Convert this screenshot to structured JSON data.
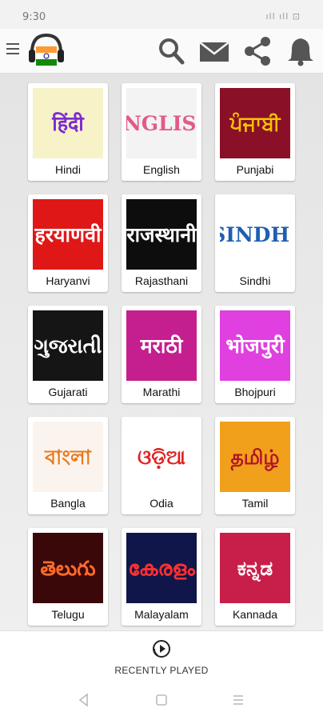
{
  "status": {
    "time": "9:30",
    "signal_text": "ıll ıll ⊡"
  },
  "header": {
    "menu_icon": "hamburger-icon",
    "logo_icon": "india-flag-headphones-icon",
    "actions": [
      "search-icon",
      "mail-icon",
      "share-icon",
      "bell-icon"
    ]
  },
  "languages": [
    {
      "label": "Hindi",
      "script": "हिंदी",
      "bg": "#f7f2c8",
      "fg": "#7b2bd1"
    },
    {
      "label": "English",
      "script": "ENGLISH",
      "bg": "#f3f3f3",
      "fg": "#e25a8a"
    },
    {
      "label": "Punjabi",
      "script": "ਪੰਜਾਬੀ",
      "bg": "#8a1028",
      "fg": "#f4c400"
    },
    {
      "label": "Haryanvi",
      "script": "हरयाणवी",
      "bg": "#e01717",
      "fg": "#ffffff"
    },
    {
      "label": "Rajasthani",
      "script": "राजस्थानी",
      "bg": "#0d0d0d",
      "fg": "#ffffff"
    },
    {
      "label": "Sindhi",
      "script": "SINDHI",
      "bg": "#ffffff",
      "fg": "#1e5fb0"
    },
    {
      "label": "Gujarati",
      "script": "ગુજરાતી",
      "bg": "#151515",
      "fg": "#ffffff"
    },
    {
      "label": "Marathi",
      "script": "मराठी",
      "bg": "#c51e8f",
      "fg": "#ffffff"
    },
    {
      "label": "Bhojpuri",
      "script": "भोजपुरी",
      "bg": "#e040e0",
      "fg": "#ffffff"
    },
    {
      "label": "Bangla",
      "script": "বাংলা",
      "bg": "#fbf4ee",
      "fg": "#e87a1e"
    },
    {
      "label": "Odia",
      "script": "ଓଡ଼ିଆ",
      "bg": "#ffffff",
      "fg": "#e02020"
    },
    {
      "label": "Tamil",
      "script": "தமிழ்",
      "bg": "#f0a01a",
      "fg": "#b0102a"
    },
    {
      "label": "Telugu",
      "script": "తెలుగు",
      "bg": "#3a0808",
      "fg": "#ff6a2a"
    },
    {
      "label": "Malayalam",
      "script": "കേരളം",
      "bg": "#10164a",
      "fg": "#ff3030"
    },
    {
      "label": "Kannada",
      "script": "ಕನ್ನಡ",
      "bg": "#c81e4a",
      "fg": "#ffffff"
    }
  ],
  "bottom": {
    "recently_played": "RECENTLY PLAYED",
    "play_icon": "play-circle-icon"
  },
  "nav": [
    "back-icon",
    "home-icon",
    "recents-icon"
  ]
}
